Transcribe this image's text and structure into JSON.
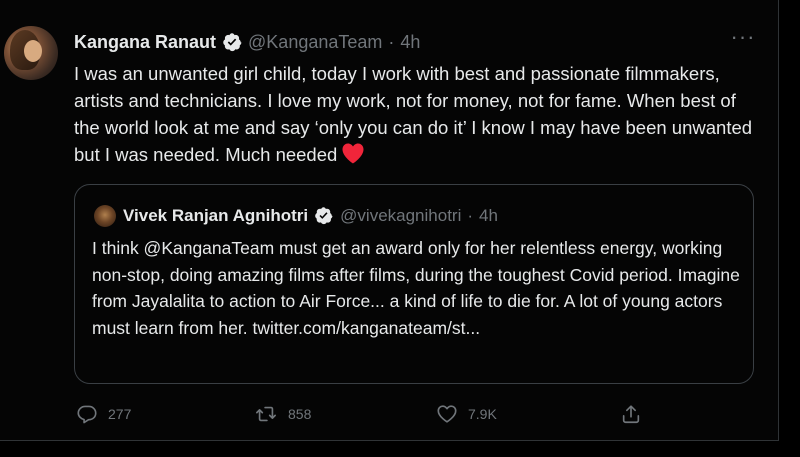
{
  "tweet": {
    "author_name": "Kangana Ranaut",
    "handle": "@KanganaTeam",
    "separator": "·",
    "time": "4h",
    "more_label": "···",
    "text": "I was an unwanted girl child, today I work with best and passionate filmmakers, artists and technicians. I love my work, not for money, not for fame. When best of the world look at me and say ‘only you can do it’ I know I may have been unwanted but I was needed. Much needed",
    "emoji": "red-heart-icon"
  },
  "quoted": {
    "author_name": "Vivek Ranjan Agnihotri",
    "handle": "@vivekagnihotri",
    "separator": "·",
    "time": "4h",
    "text": "I think @KanganaTeam must get an award only for her relentless energy, working non-stop, doing amazing films after films, during the toughest Covid period. Imagine from Jayalalita to action to Air Force... a kind of life to die for. A lot of young actors must learn from her. twitter.com/kanganateam/st..."
  },
  "actions": {
    "replies": "277",
    "retweets": "858",
    "likes": "7.9K"
  },
  "colors": {
    "background": "#000000",
    "text": "#e7e9ea",
    "muted": "#71767b",
    "border": "#3a3f44",
    "heart": "#f0253a"
  }
}
